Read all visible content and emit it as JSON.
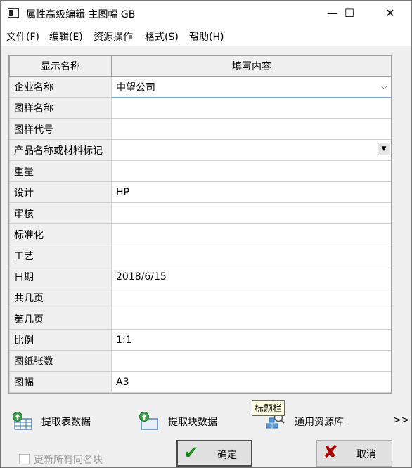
{
  "window": {
    "title": "属性高级编辑 主图幅 GB",
    "minimize": "—",
    "maximize": "☐",
    "close": "✕"
  },
  "menu": [
    {
      "label": "文件(F)"
    },
    {
      "label": "编辑(E)"
    },
    {
      "label": "资源操作"
    },
    {
      "label": "格式(S)"
    },
    {
      "label": "帮助(H)"
    }
  ],
  "grid": {
    "header_name": "显示名称",
    "header_value": "填写内容",
    "rows": [
      {
        "name": "企业名称",
        "value": "中望公司"
      },
      {
        "name": "图样名称",
        "value": ""
      },
      {
        "name": "图样代号",
        "value": ""
      },
      {
        "name": "产品名称或材料标记",
        "value": ""
      },
      {
        "name": "重量",
        "value": ""
      },
      {
        "name": "设计",
        "value": "HP"
      },
      {
        "name": "审核",
        "value": ""
      },
      {
        "name": "标准化",
        "value": ""
      },
      {
        "name": "工艺",
        "value": ""
      },
      {
        "name": "日期",
        "value": "2018/6/15"
      },
      {
        "name": "共几页",
        "value": ""
      },
      {
        "name": "第几页",
        "value": ""
      },
      {
        "name": "比例",
        "value": "1:1"
      },
      {
        "name": "图纸张数",
        "value": ""
      },
      {
        "name": "图幅",
        "value": "A3"
      }
    ],
    "chevron": "⌵",
    "dropdown_arrow": "▼"
  },
  "toolbar": {
    "extract_table": "提取表数据",
    "extract_block": "提取块数据",
    "resource_library": "通用资源库",
    "more": ">>",
    "tooltip": "标题栏"
  },
  "footer": {
    "update_same_name": "更新所有同名块",
    "ok_label": "确定",
    "cancel_label": "取消",
    "ok_icon": "✔",
    "cancel_icon": "✘"
  },
  "colors": {
    "ok_icon": "#1f8a1f",
    "cancel_icon": "#b00000",
    "selection_border": "#7a9bd8"
  }
}
